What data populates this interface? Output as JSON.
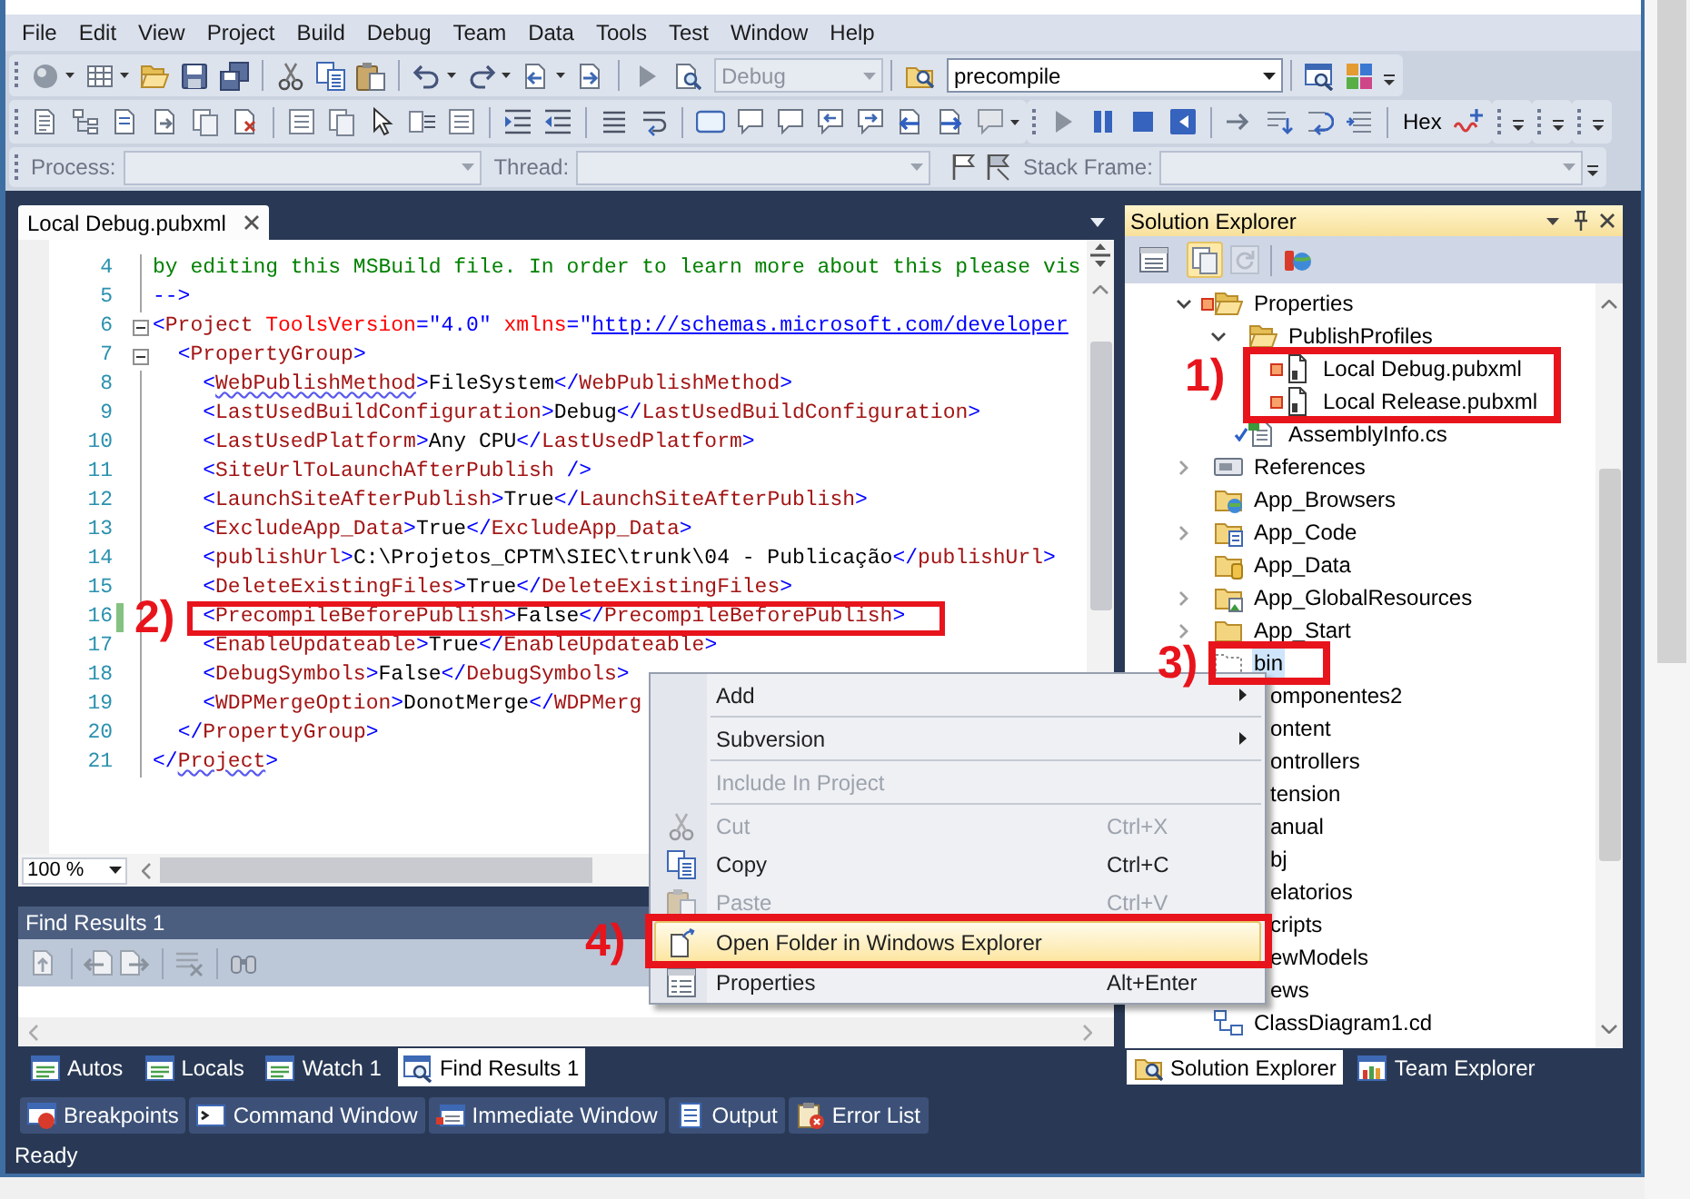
{
  "menu_bar": [
    "File",
    "Edit",
    "View",
    "Project",
    "Build",
    "Debug",
    "Team",
    "Data",
    "Tools",
    "Test",
    "Window",
    "Help"
  ],
  "standard_toolbar": {
    "configuration": {
      "value": "Debug",
      "disabled": true
    },
    "search": {
      "value": "precompile",
      "disabled": false
    }
  },
  "debug_toolbar": {
    "hex": "Hex"
  },
  "debug_location_toolbar": [
    {
      "label": "Process:",
      "disabled": true
    },
    {
      "label": "Thread:",
      "disabled": true
    },
    {
      "label": "Stack Frame:",
      "disabled": true
    }
  ],
  "editor": {
    "tabs": [
      {
        "title": "Local Debug.pubxml",
        "selected": true
      }
    ],
    "lines": [
      {
        "number": "4",
        "changed": false,
        "tokens": [
          {
            "kind": "comment",
            "text": "by editing this MSBuild file. In order to learn more about this please vis"
          }
        ]
      },
      {
        "number": "5",
        "changed": false,
        "tokens": [
          {
            "kind": "delim",
            "text": "-->"
          }
        ]
      },
      {
        "number": "6",
        "changed": false,
        "expanded": true,
        "tokens": [
          {
            "kind": "delim",
            "text": "<"
          },
          {
            "kind": "tag",
            "text": "Project"
          },
          {
            "kind": "attr",
            "text": " ToolsVersion"
          },
          {
            "kind": "delim",
            "text": "=\""
          },
          {
            "kind": "value",
            "text": "4.0"
          },
          {
            "kind": "delim",
            "text": "\""
          },
          {
            "kind": "attr",
            "text": " xmlns"
          },
          {
            "kind": "delim",
            "text": "=\""
          },
          {
            "kind": "link",
            "text": "http://schemas.microsoft.com/developer"
          }
        ]
      },
      {
        "number": "7",
        "changed": false,
        "expanded": true,
        "tokens": [
          {
            "kind": "delim",
            "text": "  <"
          },
          {
            "kind": "tag",
            "text": "PropertyGroup"
          },
          {
            "kind": "delim",
            "text": ">"
          }
        ]
      },
      {
        "number": "8",
        "changed": false,
        "tokens": [
          {
            "kind": "delim",
            "text": "    <"
          },
          {
            "kind": "flagged",
            "text": "WebPublishMethod"
          },
          {
            "kind": "delim",
            "text": ">"
          },
          {
            "kind": "text",
            "text": "FileSystem"
          },
          {
            "kind": "delim",
            "text": "</"
          },
          {
            "kind": "tag",
            "text": "WebPublishMethod"
          },
          {
            "kind": "delim",
            "text": ">"
          }
        ]
      },
      {
        "number": "9",
        "changed": false,
        "tokens": [
          {
            "kind": "delim",
            "text": "    <"
          },
          {
            "kind": "tag",
            "text": "LastUsedBuildConfiguration"
          },
          {
            "kind": "delim",
            "text": ">"
          },
          {
            "kind": "text",
            "text": "Debug"
          },
          {
            "kind": "delim",
            "text": "</"
          },
          {
            "kind": "tag",
            "text": "LastUsedBuildConfiguration"
          },
          {
            "kind": "delim",
            "text": ">"
          }
        ]
      },
      {
        "number": "10",
        "changed": false,
        "tokens": [
          {
            "kind": "delim",
            "text": "    <"
          },
          {
            "kind": "tag",
            "text": "LastUsedPlatform"
          },
          {
            "kind": "delim",
            "text": ">"
          },
          {
            "kind": "text",
            "text": "Any CPU"
          },
          {
            "kind": "delim",
            "text": "</"
          },
          {
            "kind": "tag",
            "text": "LastUsedPlatform"
          },
          {
            "kind": "delim",
            "text": ">"
          }
        ]
      },
      {
        "number": "11",
        "changed": false,
        "tokens": [
          {
            "kind": "delim",
            "text": "    <"
          },
          {
            "kind": "tag",
            "text": "SiteUrlToLaunchAfterPublish"
          },
          {
            "kind": "delim",
            "text": " />"
          }
        ]
      },
      {
        "number": "12",
        "changed": false,
        "tokens": [
          {
            "kind": "delim",
            "text": "    <"
          },
          {
            "kind": "tag",
            "text": "LaunchSiteAfterPublish"
          },
          {
            "kind": "delim",
            "text": ">"
          },
          {
            "kind": "text",
            "text": "True"
          },
          {
            "kind": "delim",
            "text": "</"
          },
          {
            "kind": "tag",
            "text": "LaunchSiteAfterPublish"
          },
          {
            "kind": "delim",
            "text": ">"
          }
        ]
      },
      {
        "number": "13",
        "changed": false,
        "tokens": [
          {
            "kind": "delim",
            "text": "    <"
          },
          {
            "kind": "tag",
            "text": "ExcludeApp_Data"
          },
          {
            "kind": "delim",
            "text": ">"
          },
          {
            "kind": "text",
            "text": "True"
          },
          {
            "kind": "delim",
            "text": "</"
          },
          {
            "kind": "tag",
            "text": "ExcludeApp_Data"
          },
          {
            "kind": "delim",
            "text": ">"
          }
        ]
      },
      {
        "number": "14",
        "changed": false,
        "tokens": [
          {
            "kind": "delim",
            "text": "    <"
          },
          {
            "kind": "tag",
            "text": "publishUrl"
          },
          {
            "kind": "delim",
            "text": ">"
          },
          {
            "kind": "text",
            "text": "C:\\Projetos_CPTM\\SIEC\\trunk\\04 - Publicação"
          },
          {
            "kind": "delim",
            "text": "</"
          },
          {
            "kind": "tag",
            "text": "publishUrl"
          },
          {
            "kind": "delim",
            "text": ">"
          }
        ]
      },
      {
        "number": "15",
        "changed": false,
        "tokens": [
          {
            "kind": "delim",
            "text": "    <"
          },
          {
            "kind": "tag",
            "text": "DeleteExistingFiles"
          },
          {
            "kind": "delim",
            "text": ">"
          },
          {
            "kind": "text",
            "text": "True"
          },
          {
            "kind": "delim",
            "text": "</"
          },
          {
            "kind": "tag",
            "text": "DeleteExistingFiles"
          },
          {
            "kind": "delim",
            "text": ">"
          }
        ]
      },
      {
        "number": "16",
        "changed": true,
        "tokens": [
          {
            "kind": "delim",
            "text": "    <"
          },
          {
            "kind": "tag",
            "text": "PrecompileBeforePublish"
          },
          {
            "kind": "delim",
            "text": ">"
          },
          {
            "kind": "text",
            "text": "False"
          },
          {
            "kind": "delim",
            "text": "</"
          },
          {
            "kind": "tag",
            "text": "PrecompileBeforePublish"
          },
          {
            "kind": "delim",
            "text": ">"
          }
        ]
      },
      {
        "number": "17",
        "changed": false,
        "tokens": [
          {
            "kind": "delim",
            "text": "    <"
          },
          {
            "kind": "tag",
            "text": "EnableUpdateable"
          },
          {
            "kind": "delim",
            "text": ">"
          },
          {
            "kind": "text",
            "text": "True"
          },
          {
            "kind": "delim",
            "text": "</"
          },
          {
            "kind": "tag",
            "text": "EnableUpdateable"
          },
          {
            "kind": "delim",
            "text": ">"
          }
        ]
      },
      {
        "number": "18",
        "changed": false,
        "tokens": [
          {
            "kind": "delim",
            "text": "    <"
          },
          {
            "kind": "tag",
            "text": "DebugSymbols"
          },
          {
            "kind": "delim",
            "text": ">"
          },
          {
            "kind": "text",
            "text": "False"
          },
          {
            "kind": "delim",
            "text": "</"
          },
          {
            "kind": "tag",
            "text": "DebugSymbols"
          },
          {
            "kind": "delim",
            "text": ">"
          }
        ]
      },
      {
        "number": "19",
        "changed": false,
        "tokens": [
          {
            "kind": "delim",
            "text": "    <"
          },
          {
            "kind": "tag",
            "text": "WDPMergeOption"
          },
          {
            "kind": "delim",
            "text": ">"
          },
          {
            "kind": "text",
            "text": "DonotMerge"
          },
          {
            "kind": "delim",
            "text": "</"
          },
          {
            "kind": "tag",
            "text": "WDPMerg"
          }
        ]
      },
      {
        "number": "20",
        "changed": false,
        "tokens": [
          {
            "kind": "delim",
            "text": "  </"
          },
          {
            "kind": "tag",
            "text": "PropertyGroup"
          },
          {
            "kind": "delim",
            "text": ">"
          }
        ]
      },
      {
        "number": "21",
        "changed": false,
        "tokens": [
          {
            "kind": "delim",
            "text": "</"
          },
          {
            "kind": "flagged",
            "text": "Project"
          },
          {
            "kind": "delim",
            "text": ">"
          }
        ]
      }
    ],
    "zoom": "100 %"
  },
  "find_results": {
    "title": "Find Results 1"
  },
  "debug_tabs": [
    {
      "label": "Autos",
      "selected": false
    },
    {
      "label": "Locals",
      "selected": false
    },
    {
      "label": "Watch 1",
      "selected": false
    },
    {
      "label": "Find Results 1",
      "selected": true
    }
  ],
  "solution_explorer": {
    "title": "Solution Explorer",
    "toolbar_buttons": [
      {
        "selected": false,
        "disabled": false
      },
      {
        "selected": true,
        "disabled": false
      },
      {
        "selected": false,
        "disabled": true
      },
      {
        "selected": false,
        "disabled": false
      }
    ],
    "tree": [
      {
        "label": "Properties",
        "kind": "folder",
        "modified": true,
        "expanded": true,
        "selected": false,
        "children": [
          {
            "label": "PublishProfiles",
            "kind": "folder",
            "expanded": true,
            "selected": false,
            "children": [
              {
                "label": "Local Debug.pubxml",
                "kind": "profile",
                "modified": true,
                "selected": false
              },
              {
                "label": "Local Release.pubxml",
                "kind": "profile",
                "modified": true,
                "selected": false
              }
            ]
          },
          {
            "label": "AssemblyInfo.cs",
            "kind": "source",
            "checked_in": true,
            "selected": false
          }
        ]
      },
      {
        "label": "References",
        "kind": "references",
        "expanded": false,
        "selected": false
      },
      {
        "label": "App_Browsers",
        "kind": "browsers",
        "selected": false
      },
      {
        "label": "App_Code",
        "kind": "code",
        "expanded": false,
        "selected": false
      },
      {
        "label": "App_Data",
        "kind": "data",
        "selected": false
      },
      {
        "label": "App_GlobalResources",
        "kind": "resources",
        "expanded": false,
        "selected": false
      },
      {
        "label": "App_Start",
        "kind": "folder",
        "expanded": false,
        "selected": false
      },
      {
        "label": "bin",
        "kind": "excluded",
        "selected": true
      },
      {
        "label": "omponentes2",
        "kind": "partial",
        "selected": false
      },
      {
        "label": "ontent",
        "kind": "partial",
        "selected": false
      },
      {
        "label": "ontrollers",
        "kind": "partial",
        "selected": false
      },
      {
        "label": "tension",
        "kind": "partial",
        "selected": false
      },
      {
        "label": "anual",
        "kind": "partial",
        "selected": false
      },
      {
        "label": "bj",
        "kind": "partial",
        "selected": false
      },
      {
        "label": "elatorios",
        "kind": "partial",
        "selected": false
      },
      {
        "label": "cripts",
        "kind": "partial",
        "selected": false
      },
      {
        "label": "ewModels",
        "kind": "partial",
        "selected": false
      },
      {
        "label": "ews",
        "kind": "partial",
        "selected": false
      },
      {
        "label": "ClassDiagram1.cd",
        "kind": "diagram",
        "selected": false
      }
    ],
    "tabs": [
      {
        "label": "Solution Explorer",
        "selected": true
      },
      {
        "label": "Team Explorer",
        "selected": false
      }
    ]
  },
  "context_menu": {
    "groups": [
      [
        {
          "label": "Add",
          "submenu": true,
          "disabled": false,
          "selected": false
        }
      ],
      [
        {
          "label": "Subversion",
          "submenu": true,
          "disabled": false,
          "selected": false
        }
      ],
      [
        {
          "label": "Include In Project",
          "submenu": false,
          "disabled": true,
          "selected": false
        }
      ],
      [
        {
          "label": "Cut",
          "shortcut": "Ctrl+X",
          "submenu": false,
          "disabled": true,
          "selected": false
        },
        {
          "label": "Copy",
          "shortcut": "Ctrl+C",
          "submenu": false,
          "disabled": false,
          "selected": false
        },
        {
          "label": "Paste",
          "shortcut": "Ctrl+V",
          "submenu": false,
          "disabled": true,
          "selected": false
        },
        {
          "label": "Open Folder in Windows Explorer",
          "submenu": false,
          "disabled": false,
          "selected": true
        },
        {
          "label": "Properties",
          "shortcut": "Alt+Enter",
          "submenu": false,
          "disabled": false,
          "selected": false
        }
      ]
    ]
  },
  "tool_tabs": [
    "Breakpoints",
    "Command Window",
    "Immediate Window",
    "Output",
    "Error List"
  ],
  "annotations": [
    {
      "label": "1)"
    },
    {
      "label": "2)"
    },
    {
      "label": "3)"
    },
    {
      "label": "4)"
    }
  ],
  "status_bar": {
    "text": "Ready"
  }
}
